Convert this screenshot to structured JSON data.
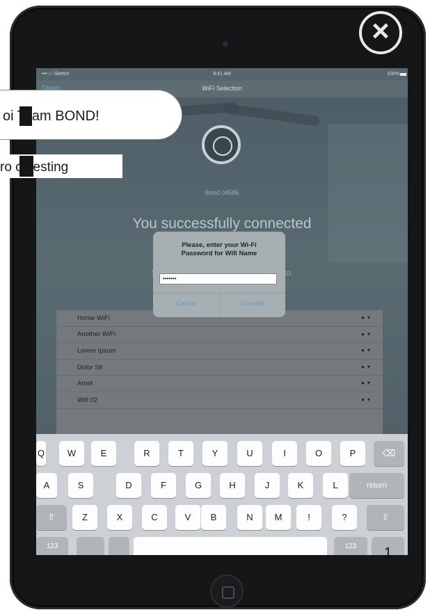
{
  "overlay": {
    "join_text": "oi  Team BOND!",
    "testing_text": "ro  ct testing",
    "page_number": "1"
  },
  "status_bar": {
    "carrier": "•••○○ Sketch",
    "time": "9:41 AM",
    "battery": "100%"
  },
  "nav_bar": {
    "cancel": "Cancel",
    "title": "WiFi Selection"
  },
  "device_name": "Bond 04586",
  "headline": "You successfully connected",
  "select_text": "Select the WiFi netw                                           e iPad to connect to.",
  "wifi_networks": [
    "Home WiFi",
    "Another WiFi",
    "Lorem Ipsum",
    "Dolor Sit",
    "Amet",
    "Wifi 02"
  ],
  "alert": {
    "title_line1": "Please, enter your Wi-Fi",
    "title_line2": "Password for Wifi Name",
    "password_value": "•••••••",
    "cancel": "Cancel",
    "connect": "Connect"
  },
  "keyboard": {
    "row1": [
      "Q",
      "W",
      "E",
      "R",
      "T",
      "Y",
      "U",
      "I",
      "O",
      "P"
    ],
    "row2": [
      "A",
      "S",
      "D",
      "F",
      "G",
      "H",
      "J",
      "K",
      "L"
    ],
    "row3": [
      "Z",
      "X",
      "C",
      "V",
      "B",
      "N",
      "M",
      "!",
      "?"
    ],
    "return": "return",
    "numbers": "123",
    "icons": {
      "delete": "⌫",
      "shift": "⇧"
    }
  },
  "colors": {
    "device_body": "#151617",
    "screen": "#4d5a60",
    "alert_button": "#5e9cc0"
  }
}
